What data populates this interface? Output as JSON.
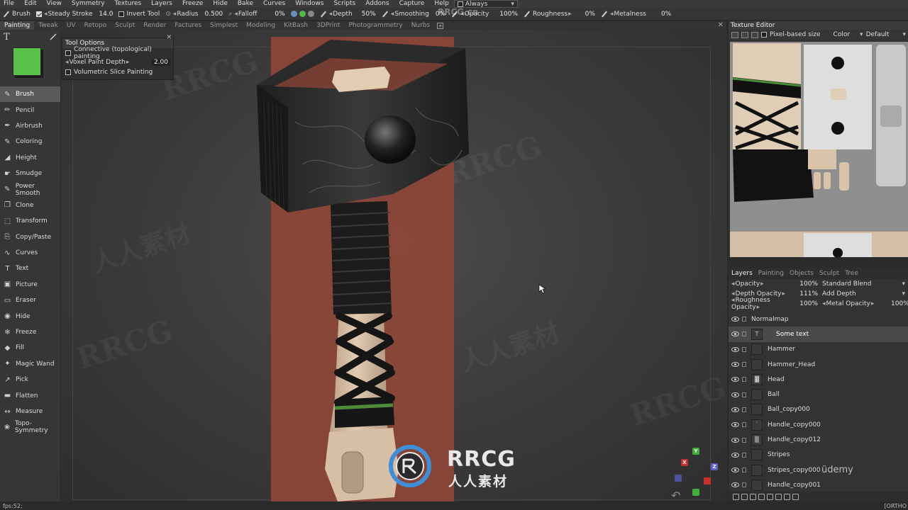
{
  "menu": [
    "File",
    "Edit",
    "View",
    "Symmetry",
    "Textures",
    "Layers",
    "Freeze",
    "Hide",
    "Bake",
    "Curves",
    "Windows",
    "Scripts",
    "Addons",
    "Capture",
    "Help"
  ],
  "always_label": "Always",
  "toolbar": {
    "brush_label": "Brush",
    "steady_stroke": "Steady Stroke",
    "steady_value": "14.0",
    "invert_tool": "Invert Tool",
    "radius_label": "Radius",
    "radius_value": "0.500",
    "falloff_label": "Falloff",
    "falloff_value": "0%",
    "depth_label": "Depth",
    "depth_value": "50%",
    "smoothing_label": "Smoothing",
    "smoothing_value": "0%",
    "opacity_label": "Opacity",
    "opacity_value": "100%",
    "roughness_label": "Roughness",
    "roughness_value": "0%",
    "metalness_label": "Metalness",
    "metalness_value": "0%"
  },
  "tabs": [
    "Painting",
    "Tweak",
    "UV",
    "Retopo",
    "Sculpt",
    "Render",
    "Factures",
    "Simplest",
    "Modeling",
    "KitBash",
    "3DPrint",
    "Photogrammetry",
    "Nurbs"
  ],
  "active_tab": "Painting",
  "current_color": "#5ac14a",
  "tools": [
    {
      "label": "Brush",
      "icon": "brush-icon",
      "glyph": "✎",
      "active": true
    },
    {
      "label": "Pencil",
      "icon": "pencil-icon",
      "glyph": "✏"
    },
    {
      "label": "Airbrush",
      "icon": "airbrush-icon",
      "glyph": "✒"
    },
    {
      "label": "Coloring",
      "icon": "coloring-icon",
      "glyph": "✎"
    },
    {
      "label": "Height",
      "icon": "height-icon",
      "glyph": "◢"
    },
    {
      "label": "Smudge",
      "icon": "smudge-icon",
      "glyph": "☛"
    },
    {
      "label": "Power Smooth",
      "icon": "power-smooth-icon",
      "glyph": "✎"
    },
    {
      "label": "Clone",
      "icon": "clone-icon",
      "glyph": "❐"
    },
    {
      "label": "Transform",
      "icon": "transform-icon",
      "glyph": "⬚"
    },
    {
      "label": "Copy/Paste",
      "icon": "copy-paste-icon",
      "glyph": "⎘"
    },
    {
      "label": "Curves",
      "icon": "curves-icon",
      "glyph": "∿"
    },
    {
      "label": "Text",
      "icon": "text-icon",
      "glyph": "T"
    },
    {
      "label": "Picture",
      "icon": "picture-icon",
      "glyph": "▣"
    },
    {
      "label": "Eraser",
      "icon": "eraser-icon",
      "glyph": "▭"
    },
    {
      "label": "Hide",
      "icon": "hide-icon",
      "glyph": "◉"
    },
    {
      "label": "Freeze",
      "icon": "freeze-icon",
      "glyph": "❄"
    },
    {
      "label": "Fill",
      "icon": "fill-icon",
      "glyph": "◆"
    },
    {
      "label": "Magic Wand",
      "icon": "magic-wand-icon",
      "glyph": "✦"
    },
    {
      "label": "Pick",
      "icon": "pick-icon",
      "glyph": "↗"
    },
    {
      "label": "Flatten",
      "icon": "flatten-icon",
      "glyph": "▬"
    },
    {
      "label": "Measure",
      "icon": "measure-icon",
      "glyph": "↔"
    },
    {
      "label": "Topo-Symmetry",
      "icon": "topo-symmetry-icon",
      "glyph": "❀"
    }
  ],
  "tool_options": {
    "title": "Tool Options",
    "connective": "Connective (topological) painting",
    "voxel_depth_label": "Voxel Paint Depth",
    "voxel_depth_value": "2.00",
    "volumetric": "Volumetric Slice Painting"
  },
  "texture_editor": {
    "title": "Texture Editor",
    "pixel_based": "Pixel-based size",
    "color_mode": "Color",
    "preset": "Default"
  },
  "layers_panel": {
    "tabs": [
      "Layers",
      "Painting",
      "Objects",
      "Sculpt",
      "Tree"
    ],
    "opacity_label": "Opacity",
    "opacity_value": "100%",
    "blend_mode": "Standard Blend",
    "depth_opacity_label": "Depth Opacity",
    "depth_opacity_value": "111%",
    "depth_mode": "Add Depth",
    "roughness_opacity_label": "Roughness Opacity",
    "roughness_opacity_value": "100%",
    "metal_opacity_label": "Metal Opacity",
    "metal_opacity_value": "100%",
    "layers": [
      {
        "name": "Normalmap",
        "thumb": ""
      },
      {
        "name": "Some text",
        "thumb": "T",
        "active": true
      },
      {
        "name": "Hammer",
        "thumb": ""
      },
      {
        "name": "Hammer_Head",
        "thumb": ""
      },
      {
        "name": "Head",
        "thumb": "▓"
      },
      {
        "name": "Ball",
        "thumb": ""
      },
      {
        "name": "Ball_copy000",
        "thumb": ""
      },
      {
        "name": "Handle_copy000",
        "thumb": "˙"
      },
      {
        "name": "Handle_copy012",
        "thumb": "▒"
      },
      {
        "name": "Stripes",
        "thumb": ""
      },
      {
        "name": "Stripes_copy000",
        "thumb": ""
      },
      {
        "name": "Handle_copy001",
        "thumb": ""
      }
    ]
  },
  "status": {
    "fps": "fps:52;",
    "view_mode": "[ORTHO"
  },
  "watermark": {
    "main": "RRCG",
    "sub": "人人素材",
    "udemy": "üdemy",
    "top": "RRCG.cn"
  },
  "gizmo": {
    "y": "Y",
    "x": "X",
    "z": "Z"
  }
}
